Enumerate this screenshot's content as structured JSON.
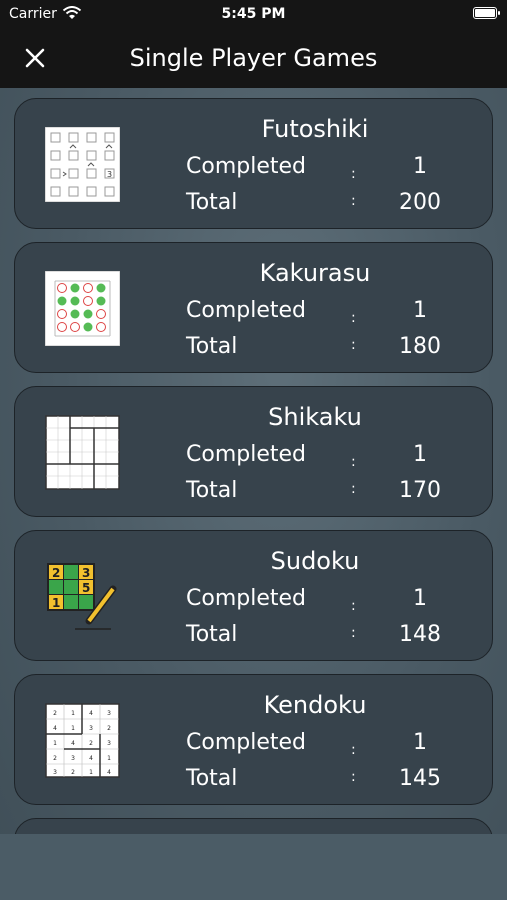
{
  "status": {
    "carrier": "Carrier",
    "time": "5:45 PM"
  },
  "nav": {
    "title": "Single Player Games",
    "close_icon": "close-icon"
  },
  "labels": {
    "completed": "Completed",
    "total": "Total",
    "colon": ":"
  },
  "games": [
    {
      "name": "Futoshiki",
      "completed": "1",
      "total": "200",
      "icon": "futoshiki-thumbnail"
    },
    {
      "name": "Kakurasu",
      "completed": "1",
      "total": "180",
      "icon": "kakurasu-thumbnail"
    },
    {
      "name": "Shikaku",
      "completed": "1",
      "total": "170",
      "icon": "shikaku-thumbnail"
    },
    {
      "name": "Sudoku",
      "completed": "1",
      "total": "148",
      "icon": "sudoku-thumbnail"
    },
    {
      "name": "Kendoku",
      "completed": "1",
      "total": "145",
      "icon": "kendoku-thumbnail"
    }
  ],
  "thumb_text": {
    "futoshiki": [
      "3"
    ],
    "sudoku": [
      "2",
      "3",
      "5",
      "1"
    ],
    "kendoku": [
      "2",
      "1",
      "4",
      "3",
      "4",
      "1",
      "3",
      "2",
      "1",
      "4",
      "2",
      "3",
      "2",
      "3",
      "4",
      "1",
      "3",
      "2",
      "1",
      "4"
    ]
  }
}
